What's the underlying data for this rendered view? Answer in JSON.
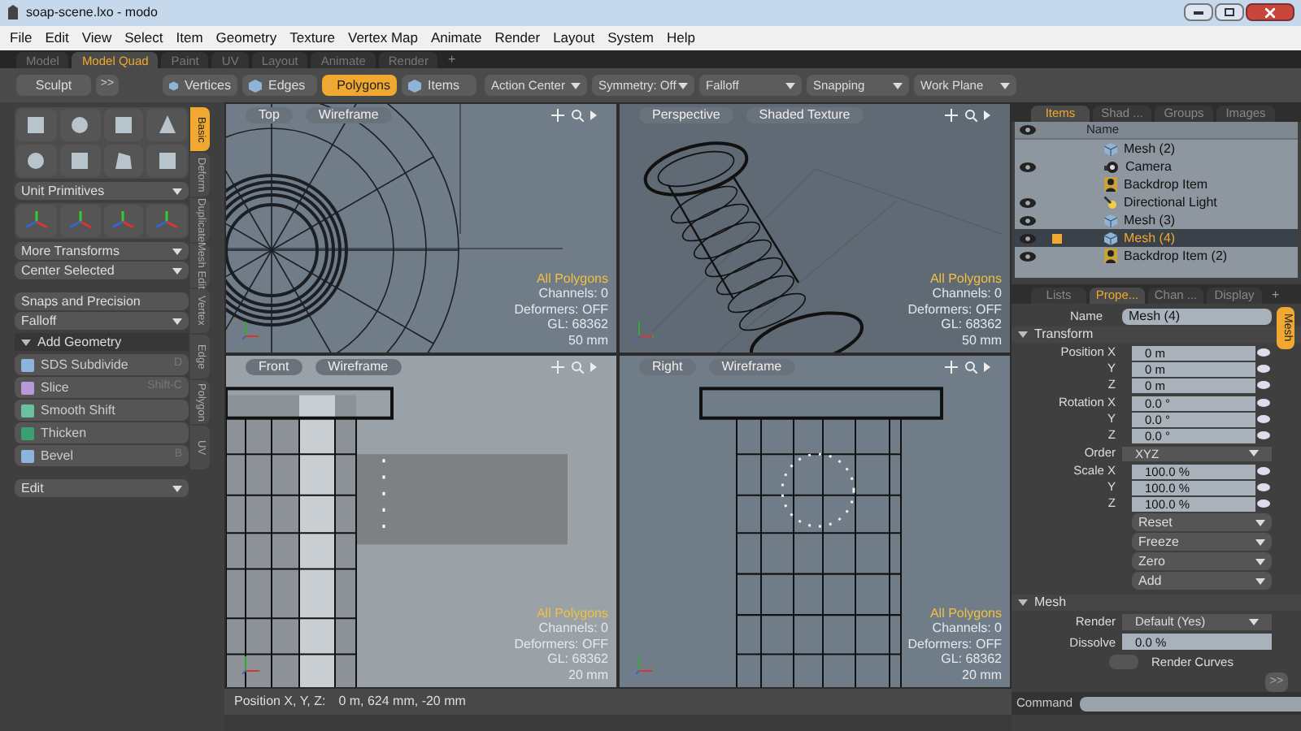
{
  "window": {
    "title": "soap-scene.lxo - modo"
  },
  "menu": [
    "File",
    "Edit",
    "View",
    "Select",
    "Item",
    "Geometry",
    "Texture",
    "Vertex Map",
    "Animate",
    "Render",
    "Layout",
    "System",
    "Help"
  ],
  "workspace_tabs": [
    {
      "label": "Model",
      "selected": false
    },
    {
      "label": "Model Quad",
      "selected": true
    },
    {
      "label": "Paint",
      "selected": false
    },
    {
      "label": "UV",
      "selected": false
    },
    {
      "label": "Layout",
      "selected": false
    },
    {
      "label": "Animate",
      "selected": false
    },
    {
      "label": "Render",
      "selected": false
    }
  ],
  "add_tab": "+",
  "toolbar": {
    "sculpt": "Sculpt",
    "more": ">>",
    "selection_modes": [
      {
        "label": "Vertices",
        "selected": false
      },
      {
        "label": "Edges",
        "selected": false
      },
      {
        "label": "Polygons",
        "selected": true
      },
      {
        "label": "Items",
        "selected": false
      }
    ],
    "dropdowns": [
      "Action Center",
      "Symmetry: Off",
      "Falloff",
      "Snapping",
      "Work Plane"
    ]
  },
  "tool_panel": {
    "primitives_dropdown": "Unit Primitives",
    "transform_dropdowns": [
      "More Transforms",
      "Center Selected"
    ],
    "snaps": "Snaps and Precision",
    "falloff": "Falloff",
    "add_geometry": {
      "label": "Add Geometry",
      "expanded": true,
      "tools": [
        {
          "label": "SDS Subdivide",
          "shortcut": "D"
        },
        {
          "label": "Slice",
          "shortcut": "Shift-C"
        },
        {
          "label": "Smooth Shift"
        },
        {
          "label": "Thicken"
        },
        {
          "label": "Bevel",
          "shortcut": "B"
        }
      ]
    },
    "edit": "Edit",
    "side_tabs": [
      {
        "label": "Basic",
        "selected": true
      },
      {
        "label": "Deform",
        "selected": false
      },
      {
        "label": "Duplicate",
        "selected": false
      },
      {
        "label": "Mesh Edit",
        "selected": false
      },
      {
        "label": "Vertex",
        "selected": false
      },
      {
        "label": "Edge",
        "selected": false
      },
      {
        "label": "Polygon",
        "selected": false
      },
      {
        "label": "UV",
        "selected": false
      }
    ]
  },
  "viewports": [
    {
      "kind": "top",
      "view": "Top",
      "shading": "Wireframe",
      "selection": "All Polygons",
      "stats": [
        "Channels: 0",
        "Deformers: OFF",
        "GL: 68362",
        "50 mm"
      ]
    },
    {
      "kind": "perspective",
      "view": "Perspective",
      "shading": "Shaded Texture",
      "selection": "All Polygons",
      "stats": [
        "Channels: 0",
        "Deformers: OFF",
        "GL: 68362",
        "50 mm"
      ]
    },
    {
      "kind": "front",
      "view": "Front",
      "shading": "Wireframe",
      "selection": "All Polygons",
      "stats": [
        "Channels: 0",
        "Deformers: OFF",
        "GL: 68362",
        "20 mm"
      ]
    },
    {
      "kind": "right",
      "view": "Right",
      "shading": "Wireframe",
      "selection": "All Polygons",
      "stats": [
        "Channels: 0",
        "Deformers: OFF",
        "GL: 68362",
        "20 mm"
      ]
    }
  ],
  "status_bar": {
    "label": "Position X, Y, Z:",
    "value": "0 m, 624 mm, -20 mm"
  },
  "items_panel": {
    "tabs": [
      {
        "label": "Items",
        "selected": true
      },
      {
        "label": "Shad ...",
        "selected": false
      },
      {
        "label": "Groups",
        "selected": false
      },
      {
        "label": "Images",
        "selected": false
      }
    ],
    "column": "Name",
    "rows": [
      {
        "name": "Mesh (2)",
        "kind": "mesh",
        "visible": false,
        "selected": false
      },
      {
        "name": "Camera",
        "kind": "camera",
        "visible": true,
        "selected": false
      },
      {
        "name": "Backdrop Item",
        "kind": "backdrop",
        "visible": false,
        "selected": false
      },
      {
        "name": "Directional Light",
        "kind": "light",
        "visible": true,
        "selected": false
      },
      {
        "name": "Mesh (3)",
        "kind": "mesh",
        "visible": true,
        "selected": false
      },
      {
        "name": "Mesh (4)",
        "kind": "mesh",
        "visible": true,
        "selected": true
      },
      {
        "name": "Backdrop Item (2)",
        "kind": "backdrop",
        "visible": true,
        "selected": false
      }
    ]
  },
  "properties": {
    "tabs": [
      {
        "label": "Lists",
        "selected": false
      },
      {
        "label": "Prope...",
        "selected": true
      },
      {
        "label": "Chan ...",
        "selected": false
      },
      {
        "label": "Display",
        "selected": false
      }
    ],
    "add_tab": "+",
    "side_tab": "Mesh",
    "name_label": "Name",
    "name_value": "Mesh (4)",
    "transform": {
      "label": "Transform",
      "expanded": true,
      "groups": [
        {
          "rows": [
            {
              "label": "Position X",
              "value": "0 m"
            },
            {
              "label": "Y",
              "value": "0 m"
            },
            {
              "label": "Z",
              "value": "0 m"
            }
          ]
        },
        {
          "rows": [
            {
              "label": "Rotation X",
              "value": "0.0 °"
            },
            {
              "label": "Y",
              "value": "0.0 °"
            },
            {
              "label": "Z",
              "value": "0.0 °"
            }
          ]
        }
      ],
      "order_label": "Order",
      "order_value": "XYZ",
      "scale": {
        "rows": [
          {
            "label": "Scale X",
            "value": "100.0 %"
          },
          {
            "label": "Y",
            "value": "100.0 %"
          },
          {
            "label": "Z",
            "value": "100.0 %"
          }
        ]
      },
      "actions": [
        "Reset",
        "Freeze",
        "Zero",
        "Add"
      ]
    },
    "mesh": {
      "label": "Mesh",
      "expanded": true,
      "render_label": "Render",
      "render_value": "Default (Yes)",
      "dissolve_label": "Dissolve",
      "dissolve_value": "0.0 %",
      "render_curves": {
        "label": "Render Curves",
        "checked": false
      }
    },
    "more": ">>"
  },
  "command": {
    "label": "Command"
  }
}
